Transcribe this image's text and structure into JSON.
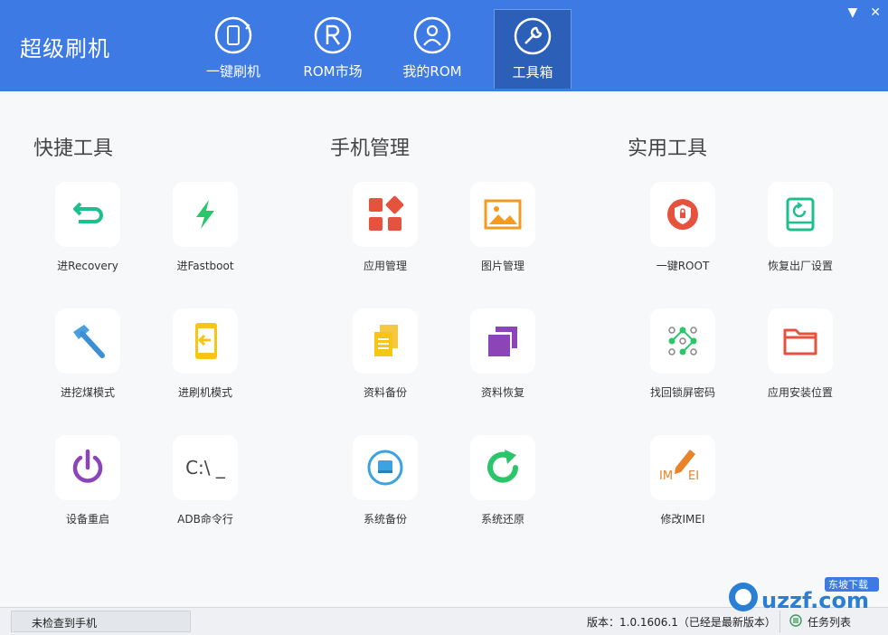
{
  "app": {
    "title": "超级刷机"
  },
  "window": {
    "minimize_glyph": "▼",
    "close_glyph": "✕"
  },
  "nav": {
    "tabs": [
      {
        "label": "一键刷机",
        "icon": "phone-refresh-icon"
      },
      {
        "label": "ROM市场",
        "icon": "rom-r-icon"
      },
      {
        "label": "我的ROM",
        "icon": "user-icon"
      },
      {
        "label": "工具箱",
        "icon": "wrench-icon",
        "active": true
      }
    ]
  },
  "sections": [
    {
      "title": "快捷工具",
      "items": [
        "进Recovery",
        "进Fastboot",
        "进挖煤模式",
        "进刷机模式",
        "设备重启",
        "ADB命令行"
      ]
    },
    {
      "title": "手机管理",
      "items": [
        "应用管理",
        "图片管理",
        "资料备份",
        "资料恢复",
        "系统备份",
        "系统还原"
      ]
    },
    {
      "title": "实用工具",
      "items": [
        "一键ROOT",
        "恢复出厂设置",
        "找回锁屏密码",
        "应用安装位置",
        "修改IMEI"
      ]
    }
  ],
  "icon_text": {
    "adb": "C:\\ _",
    "imei_left": "IM",
    "imei_right": "EI"
  },
  "colors": {
    "header": "#3d7ae3",
    "teal": "#1dbf8e",
    "green": "#2bc56a",
    "red": "#e5523e",
    "orange": "#f39a1f",
    "yellow": "#f6c516",
    "purple": "#8b45b8",
    "blue": "#3aa3e0"
  },
  "status": {
    "device": "未检查到手机",
    "version": "版本：1.0.1606.1（已经是最新版本）",
    "task_list": "任务列表"
  },
  "watermark": {
    "text": "uzzf.com",
    "tag": "东坡下载"
  }
}
